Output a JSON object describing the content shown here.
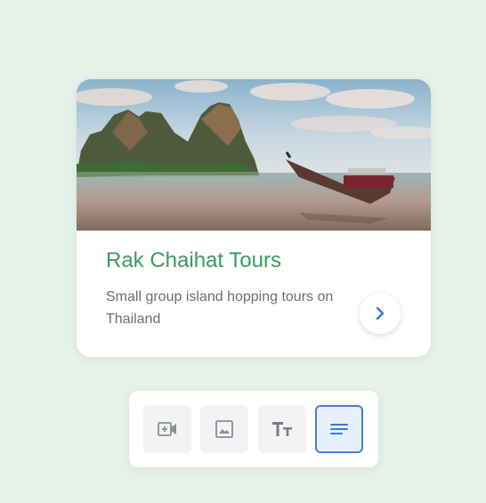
{
  "card": {
    "title": "Rak Chaihat Tours",
    "description": "Small group island hopping tours on Thailand",
    "title_color": "#3c9a5f",
    "next_icon": "chevron-right-icon"
  },
  "toolbar": {
    "tools": [
      {
        "icon": "add-video-icon",
        "active": false
      },
      {
        "icon": "image-icon",
        "active": false
      },
      {
        "icon": "text-size-icon",
        "active": false
      },
      {
        "icon": "paragraph-icon",
        "active": true
      }
    ],
    "accent_color": "#4a7fd6"
  },
  "colors": {
    "background": "#e5f2ea"
  }
}
